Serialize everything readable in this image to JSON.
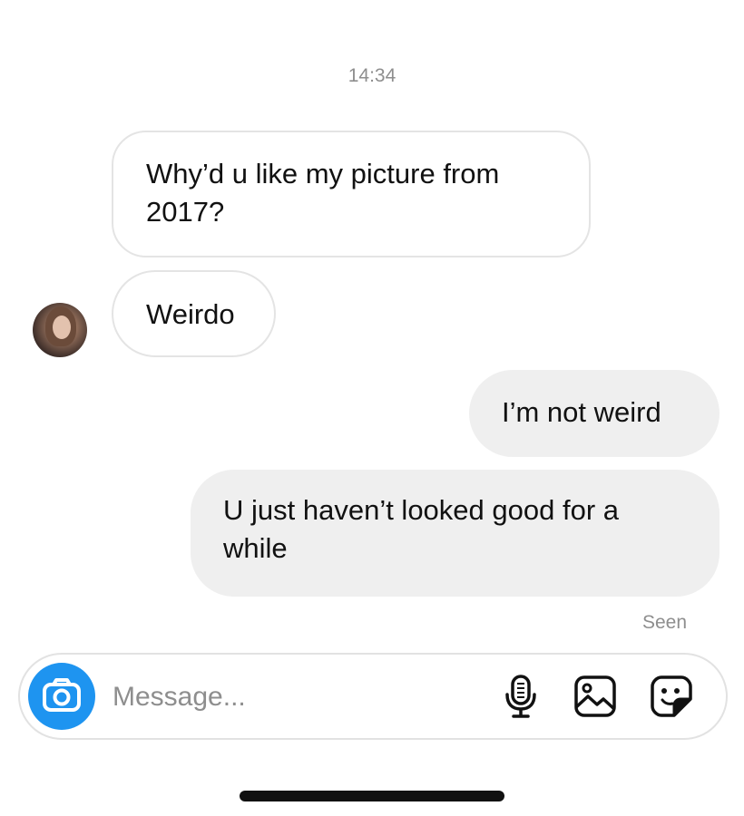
{
  "conversation": {
    "timestamp": "14:34",
    "messages": [
      {
        "direction": "incoming",
        "text": "Why’d u like my picture from 2017?"
      },
      {
        "direction": "incoming",
        "text": "Weirdo"
      },
      {
        "direction": "outgoing",
        "text": "I’m not weird"
      },
      {
        "direction": "outgoing",
        "text": "U just haven’t looked good for a while"
      }
    ],
    "seen_label": "Seen"
  },
  "composer": {
    "placeholder": "Message...",
    "camera_icon": "camera-icon",
    "mic_icon": "microphone-icon",
    "gallery_icon": "gallery-icon",
    "sticker_icon": "sticker-icon"
  },
  "colors": {
    "accent": "#1e94f0",
    "outgoing_bubble": "#efefef",
    "incoming_border": "#e4e4e4",
    "meta_text": "#8e8e8e"
  }
}
